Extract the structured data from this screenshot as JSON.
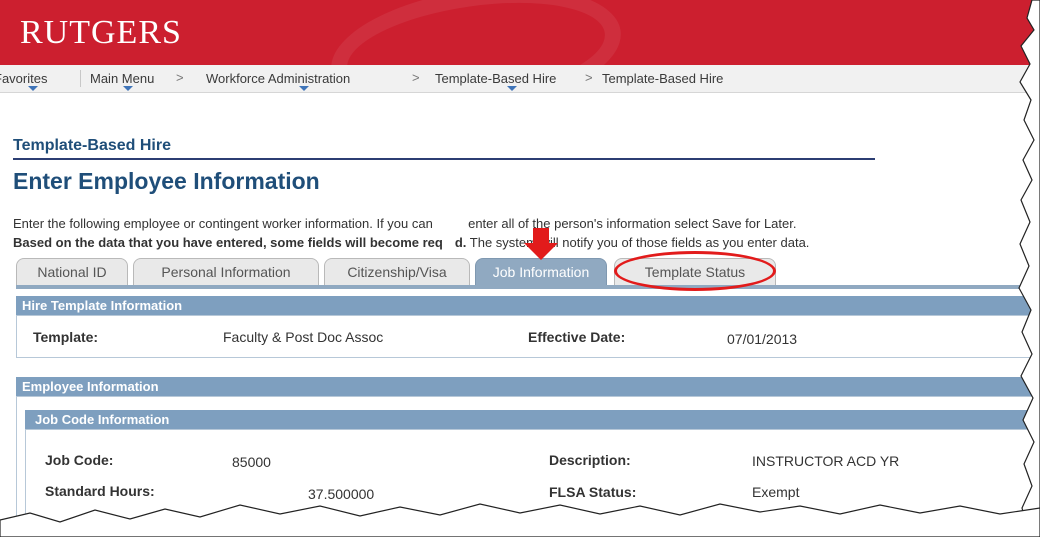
{
  "header": {
    "logo": "RUTGERS"
  },
  "breadcrumb": {
    "favorites": "Favorites",
    "main_menu": "Main Menu",
    "sep": ">",
    "workforce": "Workforce Administration",
    "template_hire_1": "Template-Based Hire",
    "template_hire_2": "Template-Based Hire"
  },
  "page": {
    "subtitle": "Template-Based Hire",
    "title": "Enter Employee Information",
    "instruction_line1_a": "Enter the following employee or contingent worker information. If you can",
    "instruction_line1_b": "enter all of the person's information select Save for Later.",
    "instruction_line2_bold": "Based on the data that you have entered, some fields will become req",
    "instruction_line2_bold_b": "d.",
    "instruction_line2_rest": "The system will notify you of those fields as you enter data."
  },
  "tabs": [
    {
      "label": "National ID"
    },
    {
      "label": "Personal Information"
    },
    {
      "label": "Citizenship/Visa"
    },
    {
      "label": "Job Information"
    },
    {
      "label": "Template Status"
    }
  ],
  "hire_template": {
    "header": "Hire Template Information",
    "template_label": "Template:",
    "template_value": "Faculty & Post Doc Assoc",
    "effective_label": "Effective Date:",
    "effective_value": "07/01/2013"
  },
  "employee": {
    "header": "Employee Information",
    "job_code_header": "Job Code Information",
    "job_code_label": "Job Code:",
    "job_code_value": "85000",
    "description_label": "Description:",
    "description_value": "INSTRUCTOR ACD YR",
    "std_hours_label": "Standard Hours:",
    "std_hours_value": "37.500000",
    "flsa_label": "FLSA Status:",
    "flsa_value": "Exempt"
  },
  "colors": {
    "brand_red": "#cc1f2f",
    "active_tab": "#90a9c1",
    "panel_header": "#7e9fbf",
    "annotation_red": "#e21b1b"
  }
}
